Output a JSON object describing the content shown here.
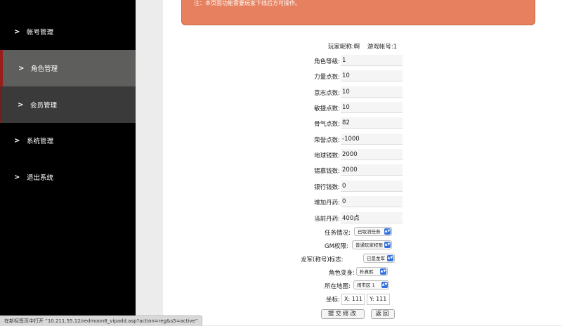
{
  "sidebar": {
    "items": [
      {
        "label": "帐号管理"
      },
      {
        "label": "角色管理"
      },
      {
        "label": "会员管理"
      },
      {
        "label": "系统管理"
      },
      {
        "label": "退出系统"
      }
    ]
  },
  "notice": "注：本页面功能需要玩家下线后方可操作。",
  "info": {
    "nickname": "玩家昵称:啊",
    "account": "游戏帐号:1"
  },
  "fields": [
    {
      "label": "角色等级:",
      "value": "1"
    },
    {
      "label": "力量点数:",
      "value": "10"
    },
    {
      "label": "意志点数:",
      "value": "10"
    },
    {
      "label": "敏捷点数:",
      "value": "10"
    },
    {
      "label": "骨气点数:",
      "value": "82"
    },
    {
      "label": "荣誉点数:",
      "value": "-1000"
    },
    {
      "label": "地球钱数:",
      "value": "2000"
    },
    {
      "label": "锡慕钱数:",
      "value": "2000"
    },
    {
      "label": "银行钱数:",
      "value": "0"
    },
    {
      "label": "增加丹药:",
      "value": "0"
    },
    {
      "label": "当前丹药:",
      "value": "400点"
    }
  ],
  "selects": [
    {
      "label": "任务情况:",
      "value": "已取消任务"
    },
    {
      "label": "GM权限:",
      "value": "普通玩家权限"
    },
    {
      "label": "龙军(称号)标志:",
      "value": "已是龙军"
    },
    {
      "label": "角色变身:",
      "value": "朴真熙"
    },
    {
      "label": "所在地图:",
      "value": "闹市区 1"
    }
  ],
  "coords": {
    "label": "坐标:",
    "x": "X: 111",
    "y": "Y: 111"
  },
  "buttons": {
    "submit": "提交修改",
    "back": "返回"
  },
  "status_bar": "在新标签页中打开 “10.211.55.12/redmoon8_vipadd.asp?action=reg&s5=active”"
}
